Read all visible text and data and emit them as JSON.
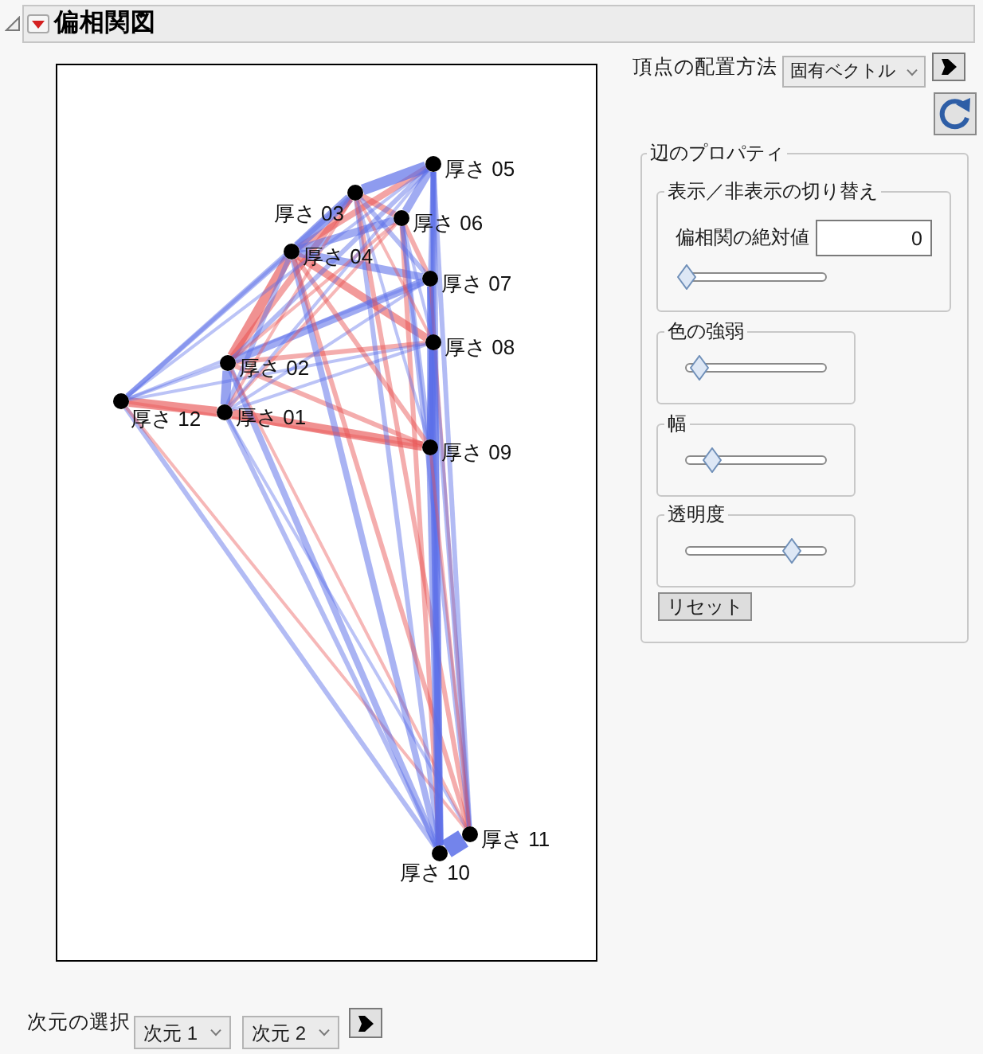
{
  "header": {
    "title": "偏相関図",
    "expanded": true
  },
  "graph": {
    "nodes": [
      {
        "label": "厚さ 05"
      },
      {
        "label": "厚さ 03"
      },
      {
        "label": "厚さ 06"
      },
      {
        "label": "厚さ 04"
      },
      {
        "label": "厚さ 07"
      },
      {
        "label": "厚さ 08"
      },
      {
        "label": "厚さ 02"
      },
      {
        "label": "厚さ 12"
      },
      {
        "label": "厚さ 01"
      },
      {
        "label": "厚さ 09"
      },
      {
        "label": "厚さ 11"
      },
      {
        "label": "厚さ 10"
      }
    ]
  },
  "layout_method": {
    "label": "頂点の配置方法",
    "value": "固有ベクトル"
  },
  "edge_properties": {
    "title": "辺のプロパティ",
    "visibility": {
      "title": "表示／非表示の切り替え",
      "field_label": "偏相関の絶対値",
      "value": "0",
      "level": 0
    },
    "sliders": [
      {
        "title": "色の強弱",
        "level": 0.1
      },
      {
        "title": "幅",
        "level": 0.2
      },
      {
        "title": "透明度",
        "level": 0.8
      }
    ],
    "reset_button": "リセット"
  },
  "dimension_select": {
    "label": "次元の選択",
    "dropdowns": [
      "次元 1",
      "次元 2"
    ]
  }
}
